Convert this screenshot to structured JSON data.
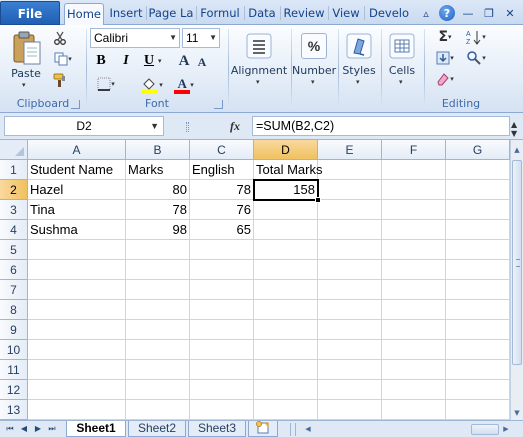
{
  "ribbon_tabs": [
    "File",
    "Home",
    "Insert",
    "Page La",
    "Formul",
    "Data",
    "Review",
    "View",
    "Develo"
  ],
  "clipboard": {
    "paste_label": "Paste",
    "group_label": "Clipboard"
  },
  "font": {
    "name": "Calibri",
    "size": "11",
    "group_label": "Font",
    "bold": "B",
    "italic": "I",
    "underline": "U",
    "grow": "A",
    "shrink": "A",
    "font_color": "A"
  },
  "alignment": {
    "label": "Alignment"
  },
  "number": {
    "label": "Number",
    "symbol": "%"
  },
  "styles": {
    "label": "Styles"
  },
  "cells": {
    "label": "Cells"
  },
  "editing": {
    "group_label": "Editing",
    "sum_symbol": "Σ"
  },
  "formula_bar": {
    "name_box": "D2",
    "fx": "fx",
    "formula": "=SUM(B2,C2)"
  },
  "columns": [
    "A",
    "B",
    "C",
    "D",
    "E",
    "F",
    "G"
  ],
  "rows": [
    "1",
    "2",
    "3",
    "4",
    "5",
    "6",
    "7",
    "8",
    "9",
    "10",
    "11",
    "12",
    "13"
  ],
  "active_cell": {
    "column": "D",
    "row": "2"
  },
  "cells_data": {
    "A1": "Student Name",
    "B1": "Marks",
    "C1": "English",
    "D1": "Total Marks",
    "A2": "Hazel",
    "B2": "80",
    "C2": "78",
    "D2": "158",
    "A3": "Tina",
    "B3": "78",
    "C3": "76",
    "A4": "Sushma",
    "B4": "98",
    "C4": "65"
  },
  "sheet_tabs": [
    "Sheet1",
    "Sheet2",
    "Sheet3"
  ],
  "active_sheet": "Sheet1",
  "colors": {
    "file_tab": "#2a6bc5",
    "selection_header": "#f3c96e",
    "grid_line": "#d4d4d4"
  }
}
